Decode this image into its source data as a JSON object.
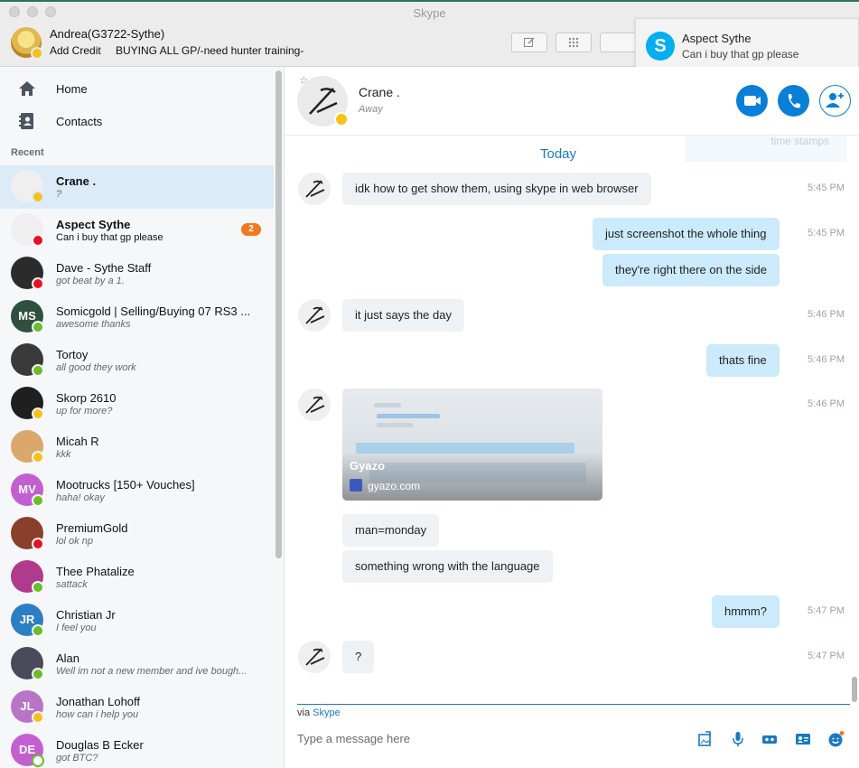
{
  "window": {
    "title": "Skype"
  },
  "me": {
    "name": "Andrea(G3722-Sythe)",
    "add_credit": "Add Credit",
    "mood": "BUYING ALL GP/-need hunter training-"
  },
  "notification": {
    "sender": "Aspect Sythe",
    "text": "Can i buy that gp please",
    "icon": "skype-logo-icon"
  },
  "nav": {
    "home": "Home",
    "contacts": "Contacts"
  },
  "recent_label": "Recent",
  "contacts": [
    {
      "name": "Crane .",
      "mood": "?",
      "status": "away",
      "selected": true,
      "bold": true,
      "avatar_text": "",
      "avatar_color": "#efefef"
    },
    {
      "name": "Aspect Sythe",
      "mood": "Can i buy that gp please",
      "status": "busy",
      "bold": true,
      "unread": "2",
      "avatar_text": "",
      "avatar_color": "#f0f0f0"
    },
    {
      "name": "Dave - Sythe Staff",
      "mood": "got beat by a 1.",
      "status": "busy",
      "avatar_text": "",
      "avatar_color": "#2b2b2b"
    },
    {
      "name": "Somicgold  | Selling/Buying 07 RS3 ...",
      "mood": "awesome thanks",
      "status": "online",
      "avatar_text": "MS",
      "avatar_color": "#2f4f3f"
    },
    {
      "name": "Tortoy",
      "mood": "all good they work",
      "status": "online",
      "avatar_text": "",
      "avatar_color": "#3a3a3a"
    },
    {
      "name": "Skorp 2610",
      "mood": "up for more?",
      "status": "away",
      "avatar_text": "",
      "avatar_color": "#1f1f1f"
    },
    {
      "name": "Micah R",
      "mood": "kkk",
      "status": "away",
      "avatar_text": "",
      "avatar_color": "#d9a86a"
    },
    {
      "name": "Mootrucks [150+ Vouches]",
      "mood": "haha! okay",
      "status": "online",
      "avatar_text": "MV",
      "avatar_color": "#c35fd1"
    },
    {
      "name": "PremiumGold",
      "mood": "lol ok np",
      "status": "busy",
      "avatar_text": "",
      "avatar_color": "#8a3f2a"
    },
    {
      "name": "Thee Phatalize",
      "mood": "sattack",
      "status": "online",
      "avatar_text": "",
      "avatar_color": "#b03a8c"
    },
    {
      "name": "Christian Jr",
      "mood": "I feel you",
      "status": "online",
      "avatar_text": "JR",
      "avatar_color": "#2d7fc4"
    },
    {
      "name": "Alan",
      "mood": "Well im not a new member and ive bough...",
      "status": "online",
      "avatar_text": "",
      "avatar_color": "#4a4a5a"
    },
    {
      "name": "Jonathan Lohoff",
      "mood": "how can i help you",
      "status": "away",
      "avatar_text": "JL",
      "avatar_color": "#b875c6"
    },
    {
      "name": "Douglas B Ecker",
      "mood": "got BTC?",
      "status": "offline",
      "avatar_text": "DE",
      "avatar_color": "#c35fd1"
    }
  ],
  "chat": {
    "contact_name": "Crane .",
    "contact_status": "Away",
    "ghost_text": "time stamps",
    "day_label": "Today",
    "image_title": "Gyazo",
    "image_site": "gyazo.com",
    "messages": [
      {
        "dir": "in",
        "text": "idk  how to get show them, using skype in web browser",
        "time": "5:45 PM"
      },
      {
        "dir": "out",
        "text": "just screenshot the whole thing",
        "time": "5:45 PM"
      },
      {
        "dir": "out",
        "text": "they're right there on the side",
        "time": ""
      },
      {
        "dir": "in",
        "text": "it just says the day",
        "time": "5:46 PM"
      },
      {
        "dir": "out",
        "text": "thats fine",
        "time": "5:46 PM"
      },
      {
        "dir": "in-image",
        "text": "",
        "time": "5:46 PM"
      },
      {
        "dir": "in",
        "text": "man=monday",
        "time": ""
      },
      {
        "dir": "in",
        "text": "something wrong with the language",
        "time": ""
      },
      {
        "dir": "out",
        "text": "hmmm?",
        "time": "5:47 PM"
      },
      {
        "dir": "in",
        "text": "?",
        "time": "5:47 PM"
      }
    ],
    "via_prefix": "via ",
    "via_link": "Skype",
    "input_placeholder": "Type a message here"
  },
  "colors": {
    "accent": "#1979c3",
    "button": "#0a7fd8",
    "bubble_out": "#cbeafb",
    "bubble_in": "#eef2f5",
    "selected": "#dcebf8"
  }
}
